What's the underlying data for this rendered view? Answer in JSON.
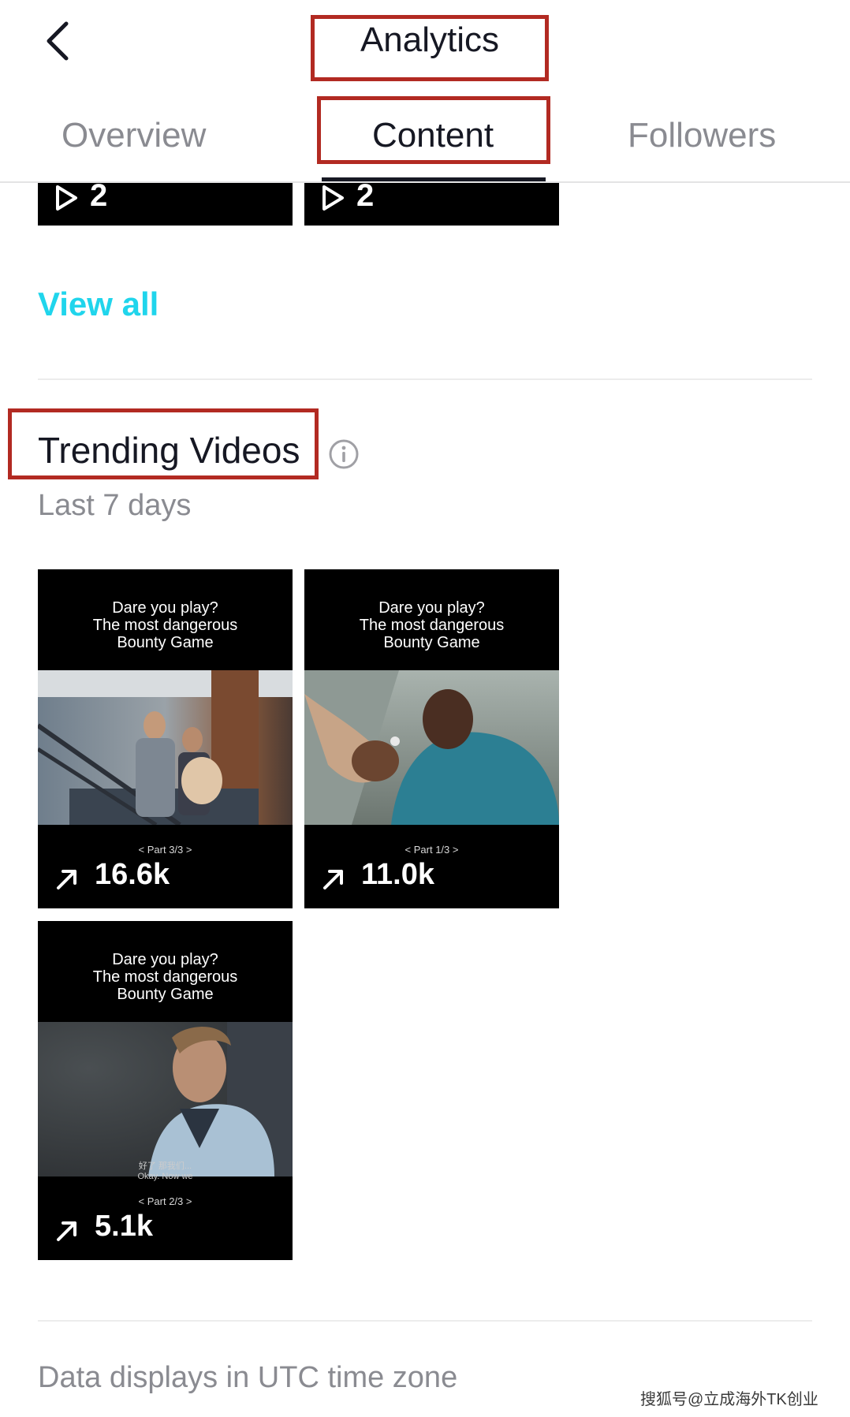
{
  "header": {
    "title": "Analytics",
    "back_icon": "chevron-left-icon"
  },
  "tabs": [
    {
      "label": "Overview",
      "active": false
    },
    {
      "label": "Content",
      "active": true
    },
    {
      "label": "Followers",
      "active": false
    }
  ],
  "partial_cards": [
    {
      "icon": "play-icon",
      "count": "2"
    },
    {
      "icon": "play-icon",
      "count": "2"
    }
  ],
  "view_all": "View all",
  "trending": {
    "title": "Trending Videos",
    "info_icon": "info-icon",
    "subtitle": "Last 7 days",
    "videos": [
      {
        "caption": [
          "Dare you play?",
          "The most dangerous",
          "Bounty Game"
        ],
        "part": "< Part 3/3 >",
        "stat": "16.6k",
        "stat_icon": "trending-arrow-icon"
      },
      {
        "caption": [
          "Dare you play?",
          "The most dangerous",
          "Bounty Game"
        ],
        "part": "< Part 1/3 >",
        "stat": "11.0k",
        "stat_icon": "trending-arrow-icon"
      },
      {
        "caption": [
          "Dare you play?",
          "The most dangerous",
          "Bounty Game"
        ],
        "part": "< Part 2/3 >",
        "stat": "5.1k",
        "stat_icon": "trending-arrow-icon",
        "subtitle_cn": "好了 那我们...",
        "subtitle_en": "Okay. Now we"
      }
    ]
  },
  "footer": {
    "note": "Data displays in UTC time zone",
    "watermark": "搜狐号@立成海外TK创业"
  },
  "colors": {
    "accent": "#20d5ec",
    "highlight_box": "#b22a22",
    "text_primary": "#161823",
    "text_secondary": "#8a8b91"
  }
}
